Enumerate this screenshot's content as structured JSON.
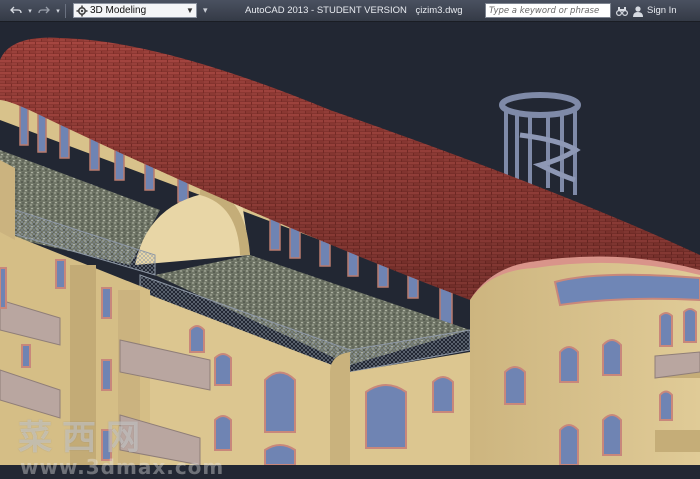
{
  "toolbar": {
    "undo_icon": "undo-icon",
    "redo_icon": "redo-icon",
    "workspace": {
      "selected": "3D Modeling",
      "icon": "gear-icon"
    },
    "title": "AutoCAD 2013 - STUDENT VERSION",
    "file": "çizim3.dwg",
    "search": {
      "placeholder": "Type a keyword or phrase"
    },
    "signin_label": "Sign In"
  },
  "viewport": {
    "background": "#222733",
    "roof_color": "#8a3630",
    "wall_color": "#d9c38c"
  },
  "watermark": {
    "chinese": "菜西网",
    "url": "www.3dmax.com"
  }
}
